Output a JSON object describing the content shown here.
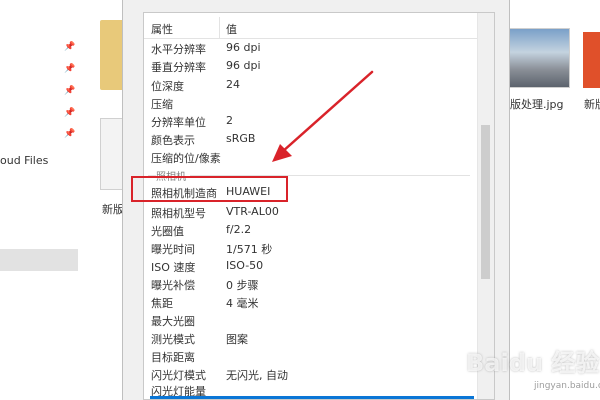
{
  "background": {
    "nav_cloud_label": "oud Files",
    "left_file_label": "新版",
    "right_file_label": "版处理.jpg",
    "far_file_label": "新版"
  },
  "dialog": {
    "header": {
      "col_name": "属性",
      "col_value": "值"
    },
    "rows_top": [
      {
        "name": "水平分辨率",
        "value": "96 dpi"
      },
      {
        "name": "垂直分辨率",
        "value": "96 dpi"
      },
      {
        "name": "位深度",
        "value": "24"
      },
      {
        "name": "压缩",
        "value": ""
      },
      {
        "name": "分辨率单位",
        "value": "2"
      },
      {
        "name": "颜色表示",
        "value": "sRGB"
      },
      {
        "name": "压缩的位/像素",
        "value": ""
      }
    ],
    "group_camera": "照相机",
    "rows_camera": [
      {
        "name": "照相机制造商",
        "value": "HUAWEI"
      },
      {
        "name": "照相机型号",
        "value": "VTR-AL00"
      },
      {
        "name": "光圈值",
        "value": "f/2.2"
      },
      {
        "name": "曝光时间",
        "value": "1/571 秒"
      },
      {
        "name": "ISO 速度",
        "value": "ISO-50"
      },
      {
        "name": "曝光补偿",
        "value": "0 步骤"
      },
      {
        "name": "焦距",
        "value": "4 毫米"
      },
      {
        "name": "最大光圈",
        "value": ""
      },
      {
        "name": "测光模式",
        "value": "图案"
      },
      {
        "name": "目标距离",
        "value": ""
      },
      {
        "name": "闪光灯模式",
        "value": "无闪光, 自动"
      },
      {
        "name": "闪光灯能量",
        "value": ""
      }
    ]
  },
  "annotation": {
    "highlight_color": "#d9232a",
    "arrow_color": "#d9232a"
  },
  "watermark": {
    "text": "Baidu 经验",
    "sub": "jingyan.baidu.com"
  }
}
